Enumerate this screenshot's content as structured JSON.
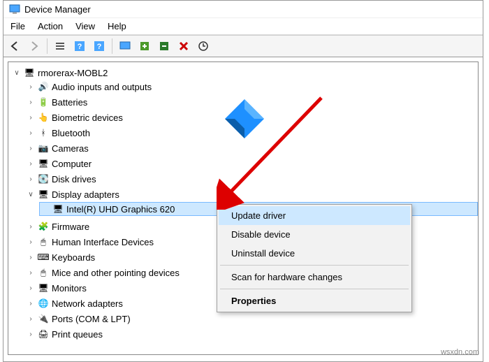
{
  "window": {
    "title": "Device Manager"
  },
  "menubar": {
    "file": "File",
    "action": "Action",
    "view": "View",
    "help": "Help"
  },
  "toolbar_icons": [
    "back",
    "forward",
    "up",
    "list",
    "help",
    "monitor",
    "update",
    "remove",
    "search",
    "stop",
    "scan"
  ],
  "tree": {
    "root": "rmorerax-MOBL2",
    "nodes": [
      {
        "label": "Audio inputs and outputs",
        "icon": "🔊"
      },
      {
        "label": "Batteries",
        "icon": "🔋"
      },
      {
        "label": "Biometric devices",
        "icon": "👆"
      },
      {
        "label": "Bluetooth",
        "icon": "ᚼ"
      },
      {
        "label": "Cameras",
        "icon": "📷"
      },
      {
        "label": "Computer",
        "icon": "🖥"
      },
      {
        "label": "Disk drives",
        "icon": "💽"
      }
    ],
    "display_adapters": {
      "label": "Display adapters",
      "child": "Intel(R) UHD Graphics 620"
    },
    "nodes_after": [
      {
        "label": "Firmware",
        "icon": "🧩"
      },
      {
        "label": "Human Interface Devices",
        "icon": "🖱"
      },
      {
        "label": "Keyboards",
        "icon": "⌨"
      },
      {
        "label": "Mice and other pointing devices",
        "icon": "🖱"
      },
      {
        "label": "Monitors",
        "icon": "🖥"
      },
      {
        "label": "Network adapters",
        "icon": "🌐"
      },
      {
        "label": "Ports (COM & LPT)",
        "icon": "🔌"
      },
      {
        "label": "Print queues",
        "icon": "🖨"
      }
    ]
  },
  "context_menu": {
    "update": "Update driver",
    "disable": "Disable device",
    "uninstall": "Uninstall device",
    "scan": "Scan for hardware changes",
    "properties": "Properties"
  },
  "watermark": "wsxdn.com"
}
